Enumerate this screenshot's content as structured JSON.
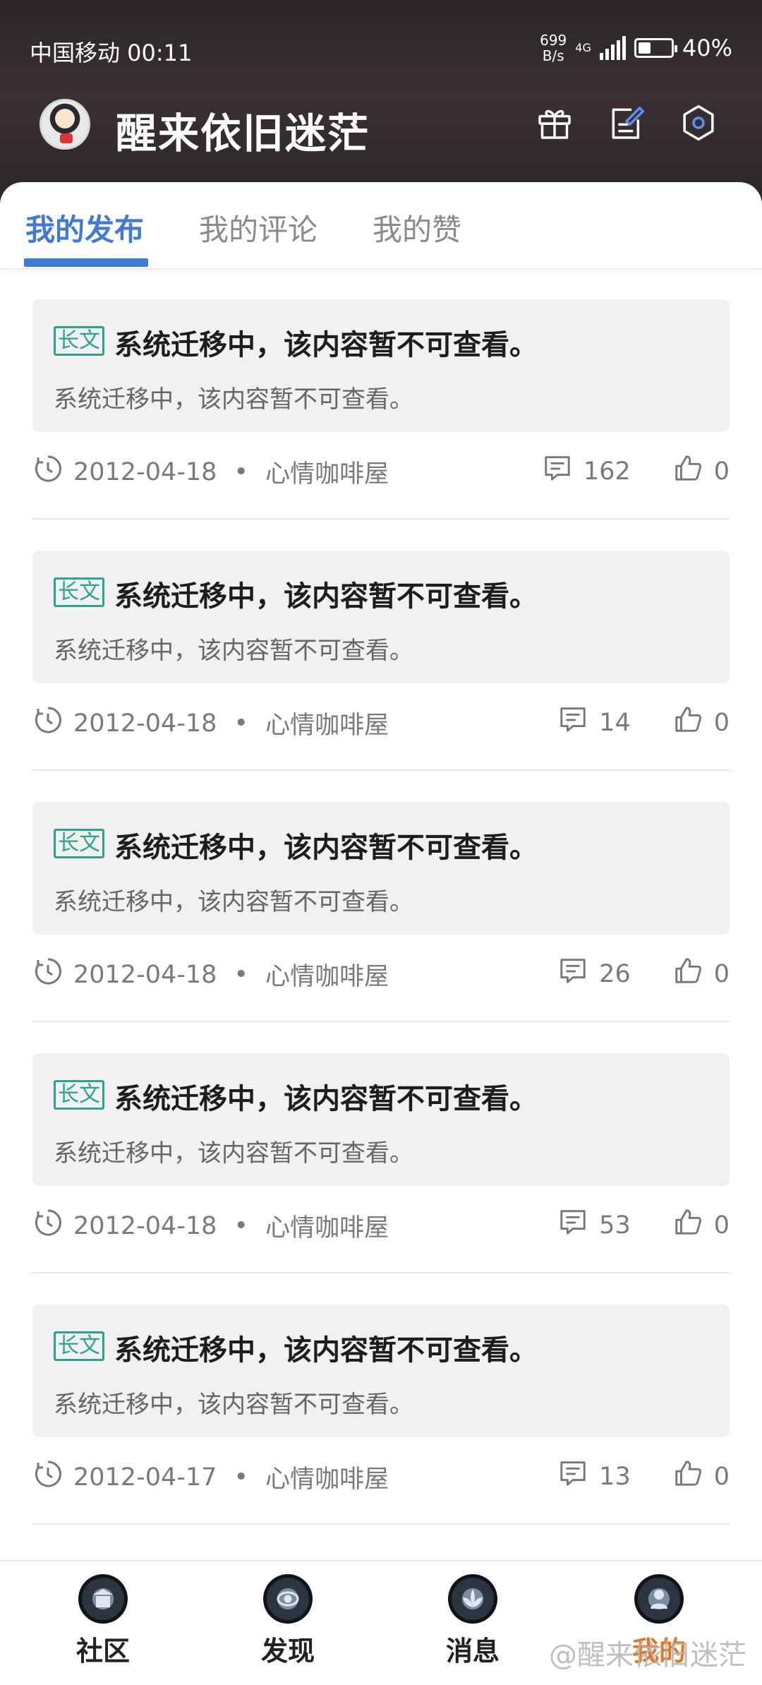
{
  "status_bar": {
    "carrier_time": "中国移动 00:11",
    "net_speed_value": "699",
    "net_speed_unit": "B/s",
    "network": "4G",
    "battery": "40%",
    "battery_level": 0.4
  },
  "header": {
    "username": "醒来依旧迷茫",
    "icons": [
      "gift-icon",
      "edit-icon",
      "settings-icon"
    ]
  },
  "tabs": [
    {
      "label": "我的发布",
      "active": true
    },
    {
      "label": "我的评论",
      "active": false
    },
    {
      "label": "我的赞",
      "active": false
    }
  ],
  "posts": [
    {
      "tag": "长文",
      "title": "系统迁移中，该内容暂不可查看。",
      "summary": "系统迁移中，该内容暂不可查看。",
      "date": "2012-04-18",
      "dot": "•",
      "category": "心情咖啡屋",
      "comments": "162",
      "likes": "0"
    },
    {
      "tag": "长文",
      "title": "系统迁移中，该内容暂不可查看。",
      "summary": "系统迁移中，该内容暂不可查看。",
      "date": "2012-04-18",
      "dot": "•",
      "category": "心情咖啡屋",
      "comments": "14",
      "likes": "0"
    },
    {
      "tag": "长文",
      "title": "系统迁移中，该内容暂不可查看。",
      "summary": "系统迁移中，该内容暂不可查看。",
      "date": "2012-04-18",
      "dot": "•",
      "category": "心情咖啡屋",
      "comments": "26",
      "likes": "0"
    },
    {
      "tag": "长文",
      "title": "系统迁移中，该内容暂不可查看。",
      "summary": "系统迁移中，该内容暂不可查看。",
      "date": "2012-04-18",
      "dot": "•",
      "category": "心情咖啡屋",
      "comments": "53",
      "likes": "0"
    },
    {
      "tag": "长文",
      "title": "系统迁移中，该内容暂不可查看。",
      "summary": "系统迁移中，该内容暂不可查看。",
      "date": "2012-04-17",
      "dot": "•",
      "category": "心情咖啡屋",
      "comments": "13",
      "likes": "0"
    }
  ],
  "bottom_nav": [
    {
      "label": "社区",
      "active": false
    },
    {
      "label": "发现",
      "active": false
    },
    {
      "label": "消息",
      "active": false
    },
    {
      "label": "我的",
      "active": true
    }
  ],
  "watermark": "@醒来依旧迷茫",
  "colors": {
    "accent": "#3f7ad8",
    "tag": "#2aa391",
    "active_nav": "#e8741d"
  }
}
